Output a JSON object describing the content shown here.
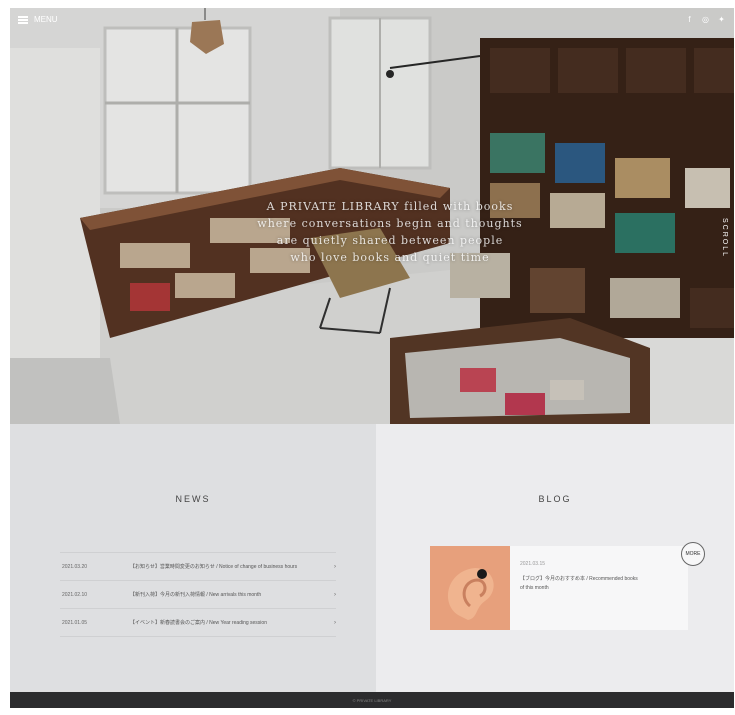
{
  "header": {
    "menu_label": "MENU",
    "social_icons": [
      "facebook-icon",
      "instagram-icon",
      "twitter-icon"
    ]
  },
  "hero": {
    "lines": [
      "A PRIVATE LIBRARY filled with books",
      "where conversations begin and thoughts",
      "are quietly shared between people",
      "who love books and quiet time"
    ],
    "side_label": "SCROLL"
  },
  "news": {
    "title": "NEWS",
    "items": [
      {
        "date": "2021.03.20",
        "title": "【お知らせ】営業時間変更のお知らせ / Notice of change of business hours",
        "arrow": "›"
      },
      {
        "date": "2021.02.10",
        "title": "【新刊入荷】今月の新刊入荷情報 / New arrivals this month",
        "arrow": "›"
      },
      {
        "date": "2021.01.05",
        "title": "【イベント】新春読書会のご案内 / New Year reading session",
        "arrow": "›"
      }
    ]
  },
  "blog": {
    "title": "BLOG",
    "more_label": "MORE",
    "post": {
      "date": "2021.03.15",
      "title_line1": "【ブログ】今月のおすすめ本 / Recommended books",
      "title_line2": "of this month"
    }
  },
  "footer": {
    "text": "© PRIVATE LIBRARY"
  },
  "colors": {
    "panel_left": "#dedfe1",
    "panel_right": "#ececee",
    "footer": "#2c2c2e",
    "thumb": "#e7a07c"
  }
}
